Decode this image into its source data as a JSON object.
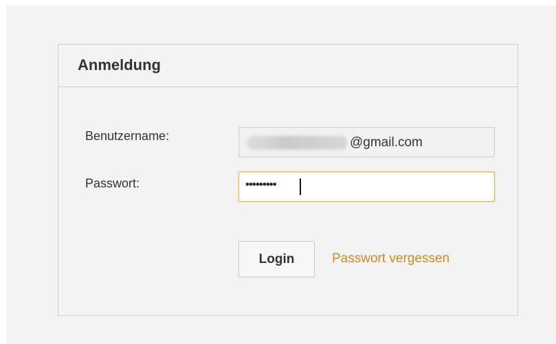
{
  "login": {
    "title": "Anmeldung",
    "username_label": "Benutzername:",
    "username_value_visible": "@gmail.com",
    "password_label": "Passwort:",
    "password_mask": "•••••••••",
    "login_button": "Login",
    "forgot_password": "Passwort vergessen"
  },
  "colors": {
    "link": "#d08a22",
    "focus_border": "#e7b33c",
    "panel_border": "#cfcfcf",
    "panel_background": "#f3f3f3"
  }
}
